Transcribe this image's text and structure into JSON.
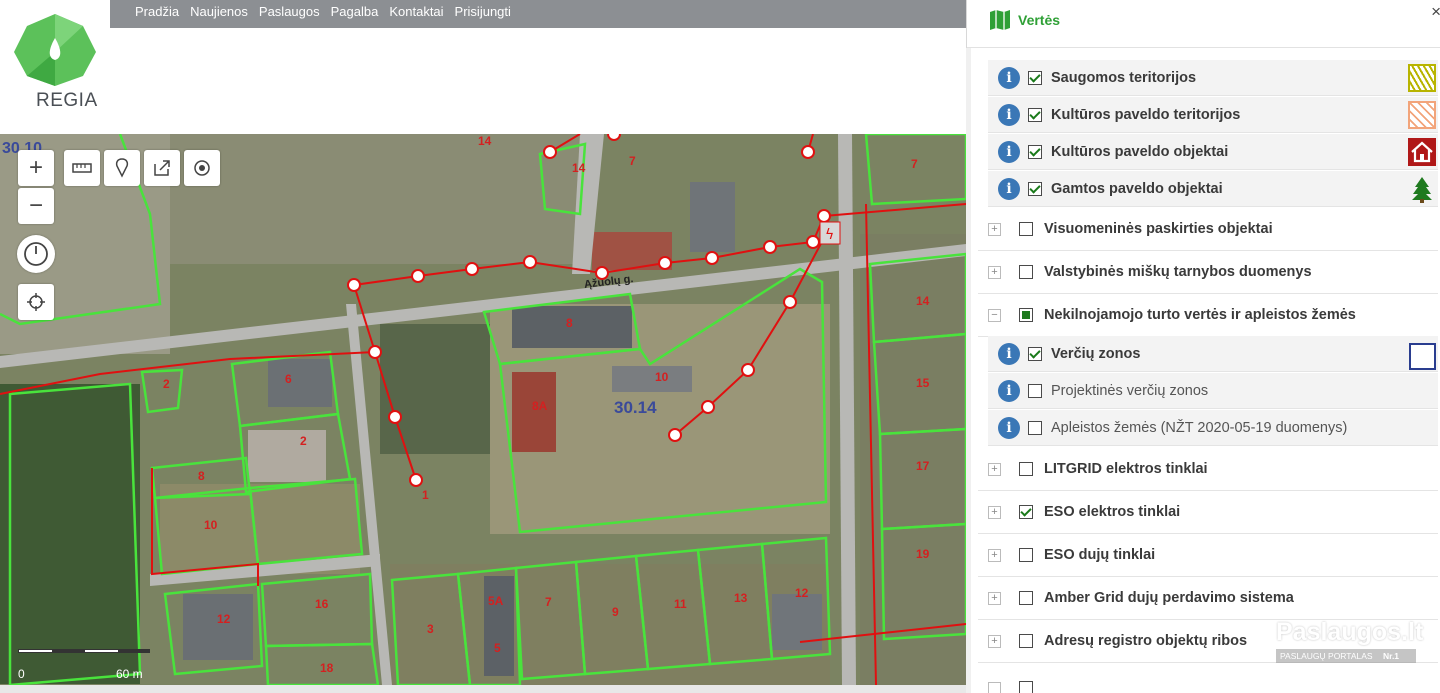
{
  "nav": [
    "Pradžia",
    "Naujienos",
    "Paslaugos",
    "Pagalba",
    "Kontaktai",
    "Prisijungti"
  ],
  "logo": {
    "text": "REGIA"
  },
  "map": {
    "street": "Ąžuolų g.",
    "zone_top_left": "30.10",
    "zone_center": "30.14",
    "scale": {
      "zero": "0",
      "end": "60 m"
    },
    "parcel_labels": [
      "14",
      "7",
      "14",
      "7",
      "8",
      "10",
      "8A",
      "6",
      "2",
      "2",
      "8",
      "10",
      "1",
      "14",
      "15",
      "17",
      "19",
      "5A",
      "7",
      "9",
      "11",
      "13",
      "12",
      "16",
      "12",
      "18",
      "3",
      "5"
    ]
  },
  "panel": {
    "title": "Vertės",
    "close": "×",
    "items": [
      {
        "label": "Saugomos teritorijos",
        "kind": "sub",
        "checked": true,
        "legend": "hatch-yellow-icon"
      },
      {
        "label": "Kultūros paveldo teritorijos",
        "kind": "sub",
        "checked": true,
        "legend": "hatch-orange-icon"
      },
      {
        "label": "Kultūros paveldo objektai",
        "kind": "sub",
        "checked": true,
        "legend": "red-house-icon"
      },
      {
        "label": "Gamtos paveldo objektai",
        "kind": "sub",
        "checked": true,
        "legend": "tree-icon"
      },
      {
        "label": "Visuomeninės paskirties objektai",
        "kind": "top",
        "checked": false,
        "expander": "+"
      },
      {
        "label": "Valstybinės miškų tarnybos duomenys",
        "kind": "top",
        "checked": false,
        "expander": "+"
      },
      {
        "label": "Nekilnojamojo turto vertės ir apleistos žemės",
        "kind": "top",
        "checked": "partial",
        "expander": "−"
      },
      {
        "label": "Verčių zonos",
        "kind": "sub",
        "checked": true,
        "legend": "blue-square-icon"
      },
      {
        "label": "Projektinės verčių zonos",
        "kind": "sub",
        "checked": false
      },
      {
        "label": "Apleistos žemės (NŽT 2020-05-19 duomenys)",
        "kind": "sub",
        "checked": false
      },
      {
        "label": "LITGRID elektros tinklai",
        "kind": "top",
        "checked": false,
        "expander": "+"
      },
      {
        "label": "ESO elektros tinklai",
        "kind": "top",
        "checked": true,
        "expander": "+"
      },
      {
        "label": "ESO dujų tinklai",
        "kind": "top",
        "checked": false,
        "expander": "+"
      },
      {
        "label": "Amber Grid dujų perdavimo sistema",
        "kind": "top",
        "checked": false,
        "expander": "+"
      },
      {
        "label": "Adresų registro objektų ribos",
        "kind": "top",
        "checked": false,
        "expander": "+"
      }
    ]
  },
  "watermark": {
    "title": "Paslaugos.lt",
    "sub": "PASLAUGŲ PORTALAS",
    "badge": "Nr.1"
  },
  "colors": {
    "accent_green": "#2fa036",
    "parcel_green": "#49e33c",
    "line_red": "#e01010",
    "info_blue": "#3a77b6"
  }
}
